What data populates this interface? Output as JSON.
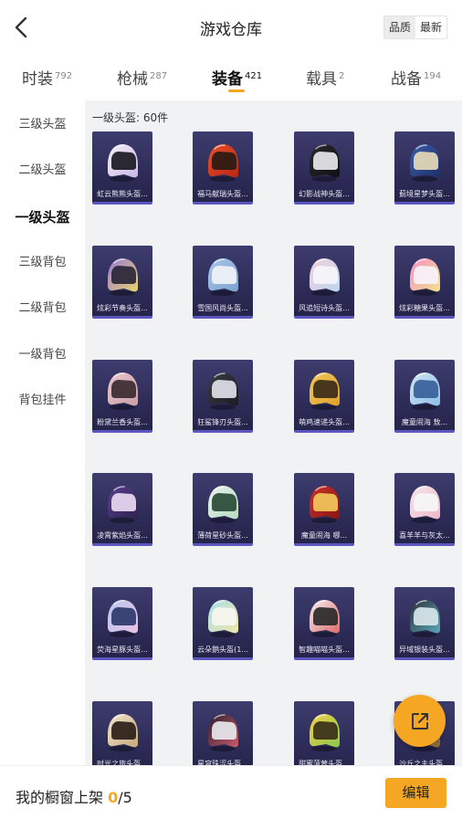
{
  "header": {
    "title": "游戏仓库",
    "sort_options": [
      {
        "label": "品质",
        "active": true
      },
      {
        "label": "最新",
        "active": false
      }
    ]
  },
  "tabs": [
    {
      "label": "时装",
      "count": "792",
      "active": false
    },
    {
      "label": "枪械",
      "count": "287",
      "active": false
    },
    {
      "label": "装备",
      "count": "421",
      "active": true
    },
    {
      "label": "载具",
      "count": "2",
      "active": false
    },
    {
      "label": "战备",
      "count": "194",
      "active": false
    }
  ],
  "side_nav": [
    {
      "label": "三级头盔",
      "active": false
    },
    {
      "label": "二级头盔",
      "active": false
    },
    {
      "label": "一级头盔",
      "active": true
    },
    {
      "label": "三级背包",
      "active": false
    },
    {
      "label": "二级背包",
      "active": false
    },
    {
      "label": "一级背包",
      "active": false
    },
    {
      "label": "背包挂件",
      "active": false
    }
  ],
  "category": {
    "title": "一级头盔: 60件"
  },
  "items": [
    {
      "label": "虹云熊熊头盔...",
      "colors": [
        "#f4eef4",
        "#c9b7e6"
      ],
      "visor": "#1a1a22"
    },
    {
      "label": "福马献瑞头盔...",
      "colors": [
        "#e8502a",
        "#b82616"
      ],
      "visor": "#2a1a14"
    },
    {
      "label": "幻影战神头盔...",
      "colors": [
        "#2a2a2e",
        "#101014"
      ],
      "visor": "#e8e8ec"
    },
    {
      "label": "蓟境星梦头盔...",
      "colors": [
        "#3a5fa8",
        "#1e2f6a"
      ],
      "visor": "#e6d9b8"
    },
    {
      "label": "炫彩节奏头盔...",
      "colors": [
        "#9a7ad8",
        "#e8d46a"
      ],
      "visor": "#2a2638"
    },
    {
      "label": "雪国风尚头盔...",
      "colors": [
        "#a9c6e8",
        "#7da2cf"
      ],
      "visor": "#f0f2f8"
    },
    {
      "label": "风追短诗头盔...",
      "colors": [
        "#f3d1dc",
        "#b9d8ee"
      ],
      "visor": "#f6f6fa"
    },
    {
      "label": "炫彩糖果头盔...",
      "colors": [
        "#f48fc8",
        "#f2e28a"
      ],
      "visor": "#f7f3fa"
    },
    {
      "label": "粉黛兰香头盔...",
      "colors": [
        "#e9c6cc",
        "#caa0a8"
      ],
      "visor": "#3a2a30"
    },
    {
      "label": "狂鲨锋刃头盔...",
      "colors": [
        "#3a3e46",
        "#1a1c22"
      ],
      "visor": "#e0e0e8"
    },
    {
      "label": "萌鸡速递头盔...",
      "colors": [
        "#f0c85a",
        "#e0a02a"
      ],
      "visor": "#3a2a1a"
    },
    {
      "label": "魔童闹海 敖...",
      "colors": [
        "#cfe6f6",
        "#8fbde6"
      ],
      "visor": "#3a5f9a"
    },
    {
      "label": "凌霄紫焰头盔...",
      "colors": [
        "#5a3f8a",
        "#2e2250"
      ],
      "visor": "#e8d9f2"
    },
    {
      "label": "薄荷星砂头盔...",
      "colors": [
        "#e8f2ea",
        "#b8d9c2"
      ],
      "visor": "#2a4a36"
    },
    {
      "label": "魔童闹海 哪...",
      "colors": [
        "#c8302a",
        "#8a1616"
      ],
      "visor": "#f2c85a"
    },
    {
      "label": "喜羊羊与灰太...",
      "colors": [
        "#f4e6ea",
        "#f0b8c8"
      ],
      "visor": "#f6f6f6"
    },
    {
      "label": "荧海星豚头盔...",
      "colors": [
        "#b8c8ee",
        "#e8c2e6"
      ],
      "visor": "#2e3a6a"
    },
    {
      "label": "云朵鹅头盔(1...",
      "colors": [
        "#a8e0ea",
        "#f0e6a8"
      ],
      "visor": "#f6f6f0"
    },
    {
      "label": "智趣喵喵头盔...",
      "colors": [
        "#f6f0f2",
        "#e06a6a"
      ],
      "visor": "#2a2a2a"
    },
    {
      "label": "异域银装头盔...",
      "colors": [
        "#2a3038",
        "#5aa8b8"
      ],
      "visor": "#d8e6ea"
    },
    {
      "label": "时光之旅头盔...",
      "colors": [
        "#f0e6d0",
        "#c8a878"
      ],
      "visor": "#2a2018"
    },
    {
      "label": "星穹珠涩头盔...",
      "colors": [
        "#2a1e2e",
        "#c85a6a"
      ],
      "visor": "#e8e8ea"
    },
    {
      "label": "甜蜜菠萝头盔...",
      "colors": [
        "#f2d04a",
        "#8ac84a"
      ],
      "visor": "#3a3018"
    },
    {
      "label": "沙丘之主头盔...",
      "colors": [
        "#c8a06a",
        "#8a6a3a"
      ],
      "visor": "#2a2016"
    }
  ],
  "footer": {
    "label_prefix": "我的橱窗上架 ",
    "shelved": "0",
    "separator": "/",
    "capacity": "5",
    "edit_label": "编辑"
  },
  "theme": {
    "accent": "#f5a623",
    "card_bg": "#2b2a55",
    "card_border": "#5b56c0",
    "content_bg": "#f1f2f4"
  },
  "icons": {
    "back": "chevron-left-icon",
    "share": "external-link-icon"
  }
}
